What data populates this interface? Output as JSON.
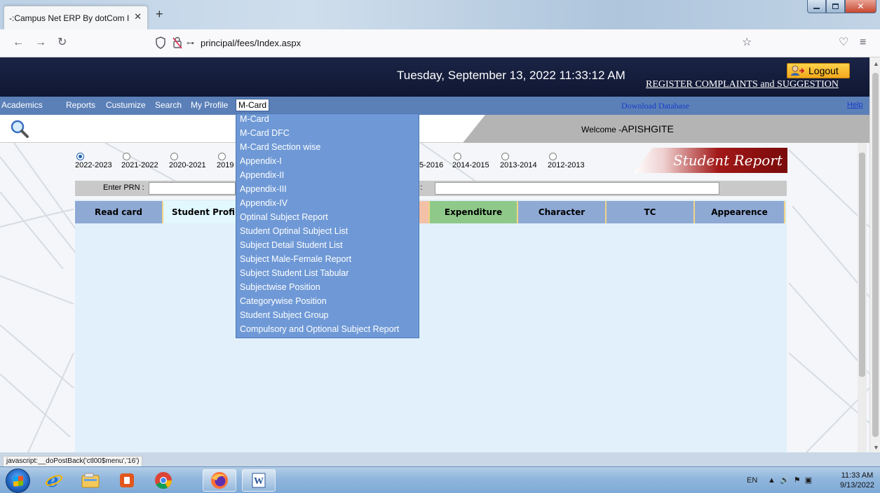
{
  "browser": {
    "tab_title": "-:Campus Net ERP By dotCom Infot",
    "new_tab_icon": "plus-icon",
    "url": "principal/fees/Index.aspx"
  },
  "header": {
    "datetime": "Tuesday, September 13, 2022 11:33:12 AM",
    "logout_label": "Logout",
    "complaints_link": "REGISTER COMPLAINTS and SUGGESTION"
  },
  "menu": {
    "items": [
      "Academics",
      "Reports",
      "Custumize",
      "Search",
      "My Profile"
    ],
    "active_item": "M-Card",
    "download_db": "Download Database",
    "help": "Help"
  },
  "welcome": {
    "prefix": "Welcome -",
    "user": "APISHGITE"
  },
  "years": {
    "visible": [
      "2022-2023",
      "2021-2022",
      "2020-2021",
      "2019",
      "5-2016",
      "2014-2015",
      "2013-2014",
      "2012-2013"
    ],
    "selected": "2022-2023"
  },
  "report_title": "Student Report",
  "search": {
    "prn_label": "Enter PRN :",
    "name_label": "me :"
  },
  "tabs": {
    "read_card": "Read card",
    "student_profile": "Student Profil",
    "expenditure": "Expenditure",
    "character": "Character",
    "tc": "TC",
    "appearence": "Appearence"
  },
  "dropdown": {
    "items": [
      "M-Card",
      "M-Card DFC",
      "M-Card Section wise",
      "Appendix-I",
      "Appendix-II",
      "Appendix-III",
      "Appendix-IV",
      "Optinal Subject Report",
      "Student Optinal Subject List",
      "Subject Detail Student List",
      "Subject Male-Female Report",
      "Subject Student List Tabular",
      "Subjectwise Position",
      "Categorywise Position",
      "Student Subject Group",
      "Compulsory and Optional Subject Report"
    ]
  },
  "status_text": "javascript:__doPostBack('ctl00$menu','16')",
  "taskbar": {
    "lang": "EN",
    "time": "11:33 AM",
    "date": "9/13/2022"
  }
}
